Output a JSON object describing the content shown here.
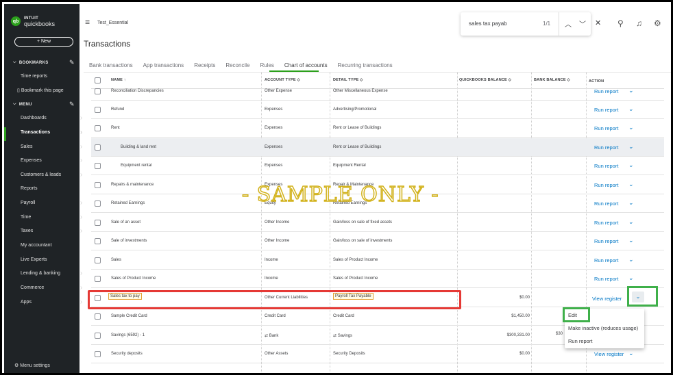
{
  "sidebar": {
    "logo_line1": "INTUIT",
    "logo_line2": "quickbooks",
    "logo_badge": "qb",
    "new_button": "+ New",
    "bookmarks_label": "BOOKMARKS",
    "bookmark_items": [
      "Time reports",
      "Bookmark this page"
    ],
    "menu_label": "MENU",
    "menu_items": [
      "Dashboards",
      "Transactions",
      "Sales",
      "Expenses",
      "Customers & leads",
      "Reports",
      "Payroll",
      "Time",
      "Taxes",
      "My accountant",
      "Live Experts",
      "Lending & banking",
      "Commerce",
      "Apps"
    ],
    "menu_settings": "Menu settings"
  },
  "header": {
    "company": "Test_Essential",
    "page_title": "Transactions",
    "search_value": "sales tax payab",
    "search_count": "1/1"
  },
  "tabs": [
    "Bank transactions",
    "App transactions",
    "Receipts",
    "Reconcile",
    "Rules",
    "Chart of accounts",
    "Recurring transactions"
  ],
  "table": {
    "headers": {
      "name": "NAME ↑",
      "account_type": "ACCOUNT TYPE ◇",
      "detail_type": "DETAIL TYPE ◇",
      "qb_balance": "QUICKBOOKS BALANCE ◇",
      "bank_balance": "BANK BALANCE ◇",
      "action": "ACTION"
    },
    "rows": [
      {
        "name": "Reconciliation Discrepancies",
        "type": "Other Expense",
        "detail": "Other Miscellaneous Expense",
        "qb": "",
        "action": "Run report"
      },
      {
        "name": "Refund",
        "type": "Expenses",
        "detail": "Advertising/Promotional",
        "qb": "",
        "action": "Run report"
      },
      {
        "name": "Rent",
        "type": "Expenses",
        "detail": "Rent or Lease of Buildings",
        "qb": "",
        "action": "Run report"
      },
      {
        "name": "Building & land rent",
        "type": "Expenses",
        "detail": "Rent or Lease of Buildings",
        "qb": "",
        "action": "Run report"
      },
      {
        "name": "Equipment rental",
        "type": "Expenses",
        "detail": "Equipment Rental",
        "qb": "",
        "action": "Run report"
      },
      {
        "name": "Repairs & maintenance",
        "type": "Expenses",
        "detail": "Repair & Maintenance",
        "qb": "",
        "action": "Run report"
      },
      {
        "name": "Retained Earnings",
        "type": "Equity",
        "detail": "Retained Earnings",
        "qb": "",
        "action": "Run report"
      },
      {
        "name": "Sale of an asset",
        "type": "Other Income",
        "detail": "Gain/loss on sale of fixed assets",
        "qb": "",
        "action": "Run report"
      },
      {
        "name": "Sale of investments",
        "type": "Other Income",
        "detail": "Gain/loss on sale of investments",
        "qb": "",
        "action": "Run report"
      },
      {
        "name": "Sales",
        "type": "Income",
        "detail": "Sales of Product Income",
        "qb": "",
        "action": "Run report"
      },
      {
        "name": "Sales of Product Income",
        "type": "Income",
        "detail": "Sales of Product Income",
        "qb": "",
        "action": "Run report"
      },
      {
        "name": "Sales tax to pay",
        "type": "Other Current Liabilities",
        "detail": "Payroll Tax Payable",
        "qb": "$0.00",
        "action": "View register"
      },
      {
        "name": "Sample Credit Card",
        "type": "Credit Card",
        "detail": "Credit Card",
        "qb": "$1,450.00",
        "action": ""
      },
      {
        "name": "Savings (6592) - 1",
        "type": "Bank",
        "detail": "Savings",
        "qb": "$300,331.00",
        "bank": "$30",
        "action": ""
      },
      {
        "name": "Security deposits",
        "type": "Other Assets",
        "detail": "Security Deposits",
        "qb": "$0.00",
        "action": "View register"
      }
    ]
  },
  "dropdown_menu": [
    "Edit",
    "Make inactive (reduces usage)",
    "Run report"
  ],
  "watermark": "- SAMPLE ONLY -"
}
